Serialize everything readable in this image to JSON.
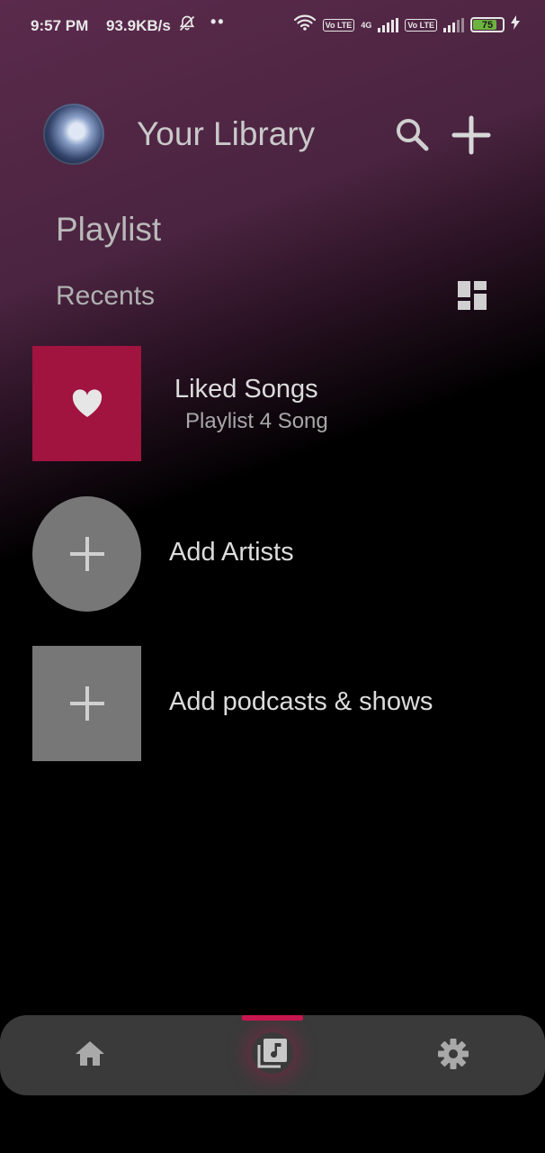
{
  "status_bar": {
    "time": "9:57 PM",
    "speed": "93.9KB/s",
    "volte1": "Vo LTE",
    "network": "4G",
    "volte2": "Vo LTE",
    "battery": "75",
    "icons": [
      "mute-icon",
      "wifi-icon",
      "signal-icon",
      "battery-icon",
      "charging-icon"
    ]
  },
  "header": {
    "title": "Your Library",
    "icons": [
      "avatar",
      "search-icon",
      "plus-icon"
    ]
  },
  "section": {
    "label": "Playlist",
    "sort_label": "Recents",
    "view_icon": "grid-view-icon"
  },
  "items": [
    {
      "title": "Liked Songs",
      "subtitle": "Playlist 4 Song",
      "icon": "heart-icon",
      "color": "#a0143f"
    },
    {
      "title": "Add Artists",
      "icon": "plus-icon"
    },
    {
      "title": "Add podcasts & shows",
      "icon": "plus-icon"
    }
  ],
  "bottom_nav": {
    "items": [
      {
        "name": "home",
        "icon": "home-icon"
      },
      {
        "name": "library",
        "icon": "library-music-icon",
        "active": true
      },
      {
        "name": "settings",
        "icon": "gear-icon"
      }
    ],
    "accent": "#c7184f"
  }
}
